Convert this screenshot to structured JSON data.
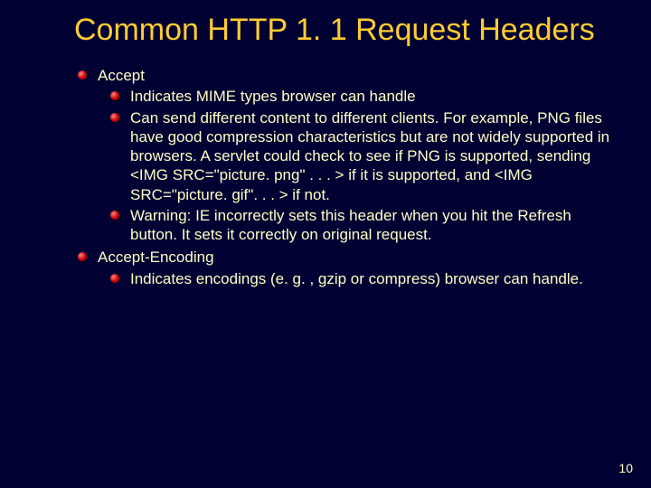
{
  "title": "Common HTTP 1. 1 Request Headers",
  "items": [
    {
      "label": "Accept",
      "sub": [
        "Indicates MIME types browser can handle",
        "Can send different content to different clients. For example, PNG files have good compression characteristics but are not widely supported in browsers. A servlet could check to see if PNG is supported, sending <IMG SRC=\"picture. png\" . . . > if it is supported, and <IMG SRC=\"picture. gif\". . . > if not.",
        "Warning: IE incorrectly sets this header when you hit the Refresh button. It sets it correctly on original request."
      ]
    },
    {
      "label": "Accept-Encoding",
      "sub": [
        "Indicates encodings (e. g. , gzip or compress) browser can handle."
      ]
    }
  ],
  "page_number": "10"
}
